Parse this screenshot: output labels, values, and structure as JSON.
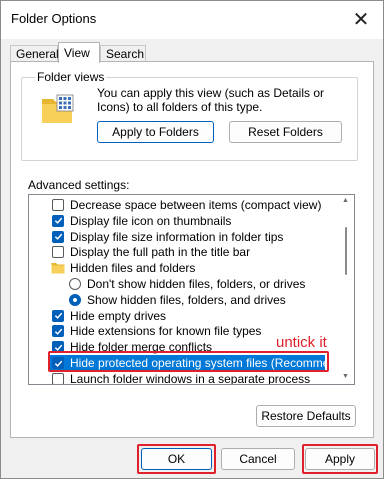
{
  "window": {
    "title": "Folder Options",
    "close_glyph": "✕"
  },
  "tabs": [
    {
      "label": "General",
      "active": false
    },
    {
      "label": "View",
      "active": true
    },
    {
      "label": "Search",
      "active": false
    }
  ],
  "folder_views": {
    "group_label": "Folder views",
    "description": "You can apply this view (such as Details or Icons) to all folders of this type.",
    "apply_button": "Apply to Folders",
    "reset_button": "Reset Folders"
  },
  "advanced": {
    "label": "Advanced settings:",
    "items": [
      {
        "text": "Decrease space between items (compact view)",
        "kind": "checkbox",
        "checked": false,
        "indent": 0
      },
      {
        "text": "Display file icon on thumbnails",
        "kind": "checkbox",
        "checked": true,
        "indent": 0
      },
      {
        "text": "Display file size information in folder tips",
        "kind": "checkbox",
        "checked": true,
        "indent": 0
      },
      {
        "text": "Display the full path in the title bar",
        "kind": "checkbox",
        "checked": false,
        "indent": 0
      },
      {
        "text": "Hidden files and folders",
        "kind": "folder",
        "checked": false,
        "indent": 0
      },
      {
        "text": "Don't show hidden files, folders, or drives",
        "kind": "radio",
        "checked": false,
        "indent": 1
      },
      {
        "text": "Show hidden files, folders, and drives",
        "kind": "radio",
        "checked": true,
        "indent": 1
      },
      {
        "text": "Hide empty drives",
        "kind": "checkbox",
        "checked": true,
        "indent": 0
      },
      {
        "text": "Hide extensions for known file types",
        "kind": "checkbox",
        "checked": true,
        "indent": 0
      },
      {
        "text": "Hide folder merge conflicts",
        "kind": "checkbox",
        "checked": true,
        "indent": 0
      },
      {
        "text": "Hide protected operating system files (Recommended)",
        "kind": "checkbox",
        "checked": true,
        "indent": 0,
        "selected": true
      },
      {
        "text": "Launch folder windows in a separate process",
        "kind": "checkbox",
        "checked": false,
        "indent": 0
      }
    ]
  },
  "annotation": {
    "text": "untick it",
    "color": "#e0202a"
  },
  "restore_button": "Restore Defaults",
  "footer": {
    "ok": "OK",
    "cancel": "Cancel",
    "apply": "Apply"
  },
  "colors": {
    "accent": "#005fb8",
    "selection": "#0078d7",
    "annotation": "#e0202a"
  }
}
